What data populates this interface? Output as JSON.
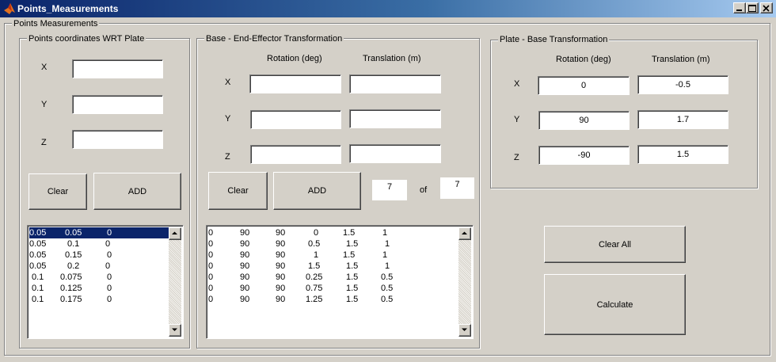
{
  "window": {
    "title": "Points_Measurements"
  },
  "main_panel": {
    "title": "Points Measurements"
  },
  "points_panel": {
    "title": "Points coordinates WRT Plate",
    "x_label": "X",
    "y_label": "Y",
    "z_label": "Z",
    "x_value": "",
    "y_value": "",
    "z_value": "",
    "clear_label": "Clear",
    "add_label": "ADD",
    "list": [
      [
        "0.05",
        "0.05",
        "0"
      ],
      [
        "0.05",
        "0.1",
        "0"
      ],
      [
        "0.05",
        "0.15",
        "0"
      ],
      [
        "0.05",
        "0.2",
        "0"
      ],
      [
        "0.1",
        "0.075",
        "0"
      ],
      [
        "0.1",
        "0.125",
        "0"
      ],
      [
        "0.1",
        "0.175",
        "0"
      ]
    ]
  },
  "base_ee_panel": {
    "title": "Base - End-Effector Transformation",
    "rotation_header": "Rotation (deg)",
    "translation_header": "Translation (m)",
    "x_label": "X",
    "y_label": "Y",
    "z_label": "Z",
    "rot_x": "",
    "rot_y": "",
    "rot_z": "",
    "trans_x": "",
    "trans_y": "",
    "trans_z": "",
    "clear_label": "Clear",
    "add_label": "ADD",
    "counter_current": "7",
    "counter_of": "of",
    "counter_total": "7",
    "list": [
      [
        "0",
        "90",
        "90",
        "0",
        "1.5",
        "1"
      ],
      [
        "0",
        "90",
        "90",
        "0.5",
        "1.5",
        "1"
      ],
      [
        "0",
        "90",
        "90",
        "1",
        "1.5",
        "1"
      ],
      [
        "0",
        "90",
        "90",
        "1.5",
        "1.5",
        "1"
      ],
      [
        "0",
        "90",
        "90",
        "0.25",
        "1.5",
        "0.5"
      ],
      [
        "0",
        "90",
        "90",
        "0.75",
        "1.5",
        "0.5"
      ],
      [
        "0",
        "90",
        "90",
        "1.25",
        "1.5",
        "0.5"
      ]
    ]
  },
  "plate_base_panel": {
    "title": "Plate - Base Transformation",
    "rotation_header": "Rotation (deg)",
    "translation_header": "Translation (m)",
    "x_label": "X",
    "y_label": "Y",
    "z_label": "Z",
    "rot_x": "0",
    "rot_y": "90",
    "rot_z": "-90",
    "trans_x": "-0.5",
    "trans_y": "1.7",
    "trans_z": "1.5"
  },
  "actions": {
    "clear_all_label": "Clear All",
    "calculate_label": "Calculate"
  },
  "icons": {
    "app": "matlab-icon",
    "minimize": "minimize-icon",
    "maximize": "maximize-icon",
    "close": "close-icon"
  }
}
